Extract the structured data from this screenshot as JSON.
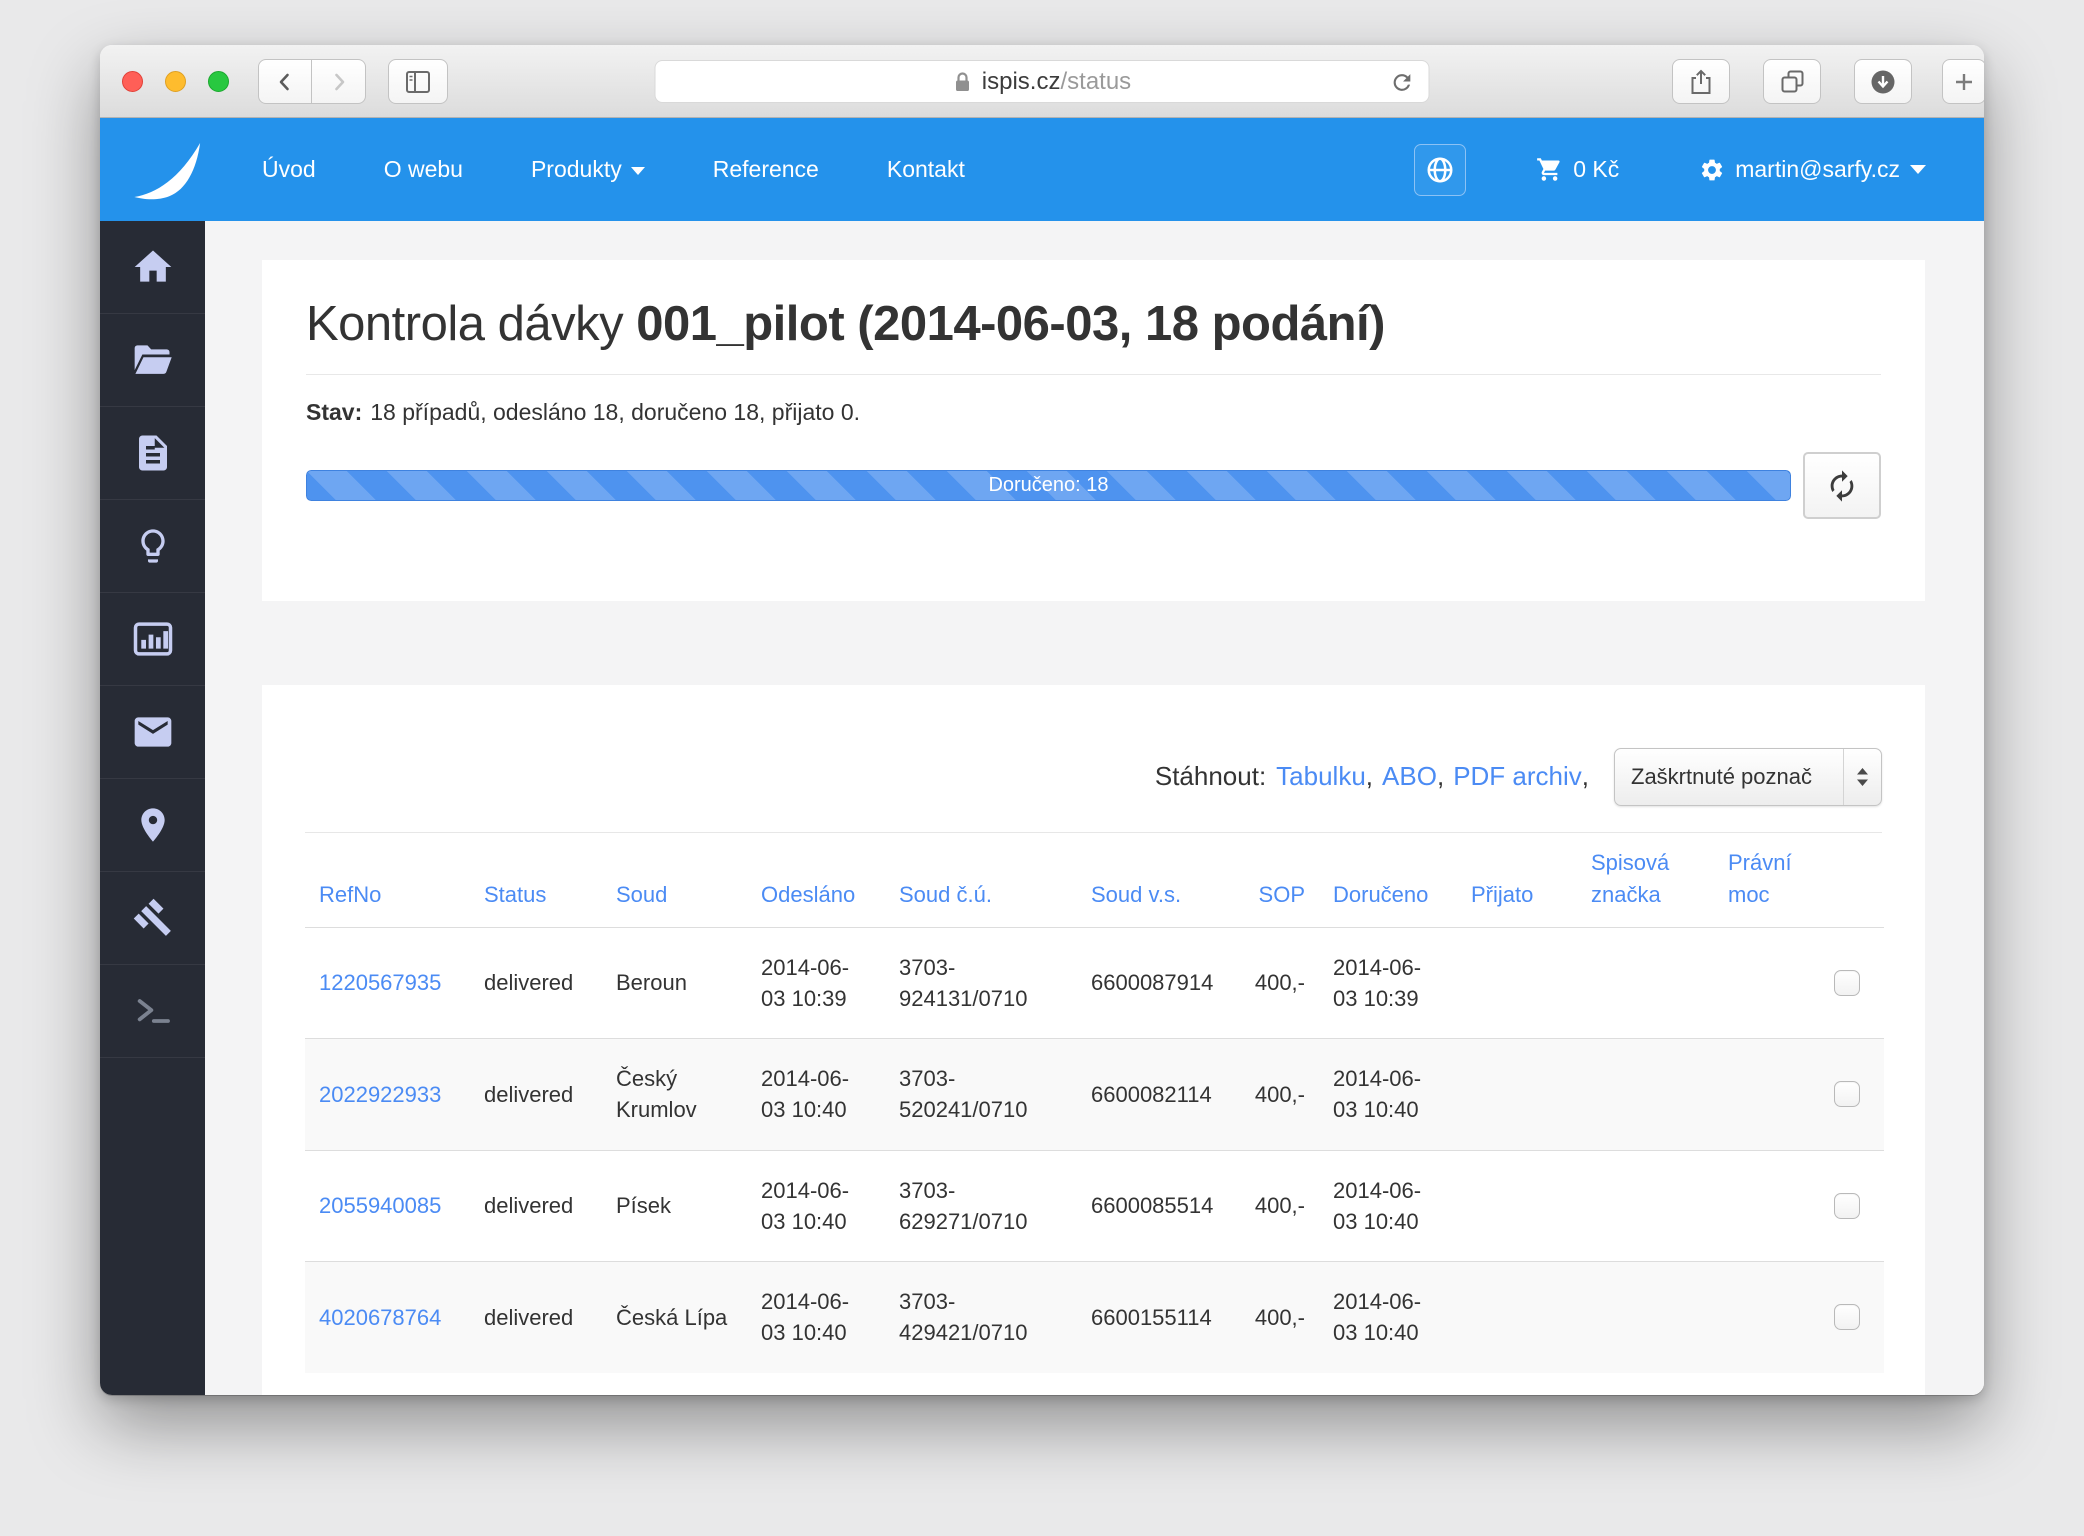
{
  "colors": {
    "navbar_blue": "#2492eb",
    "link_blue": "#4b8bf4",
    "progress_blue": "#4e93ef",
    "sidebar_bg": "#272b35",
    "sidebar_icon": "#c6cdf1"
  },
  "browser": {
    "domain": "ispis.cz",
    "path": "/status"
  },
  "navbar": {
    "items": [
      {
        "label": "Úvod"
      },
      {
        "label": "O webu"
      },
      {
        "label": "Produkty"
      },
      {
        "label": "Reference"
      },
      {
        "label": "Kontakt"
      }
    ],
    "cart_amount": "0 Kč",
    "user_email": "martin@sarfy.cz"
  },
  "status_panel": {
    "title_prefix": "Kontrola dávky ",
    "title_strong": "001_pilot (2014-06-03, 18 podání)",
    "status_label": "Stav:",
    "status_text": "18 případů, odesláno 18, doručeno 18, přijato 0.",
    "progress": {
      "label": "Doručeno: 18",
      "percent": 100
    }
  },
  "downloads": {
    "label": "Stáhnout:",
    "links": [
      {
        "label": "Tabulku"
      },
      {
        "label": "ABO"
      },
      {
        "label": "PDF archiv"
      }
    ],
    "comma": ",",
    "select_value": "Zaškrtnuté poznač"
  },
  "table": {
    "columns": [
      "RefNo",
      "Status",
      "Soud",
      "Odesláno",
      "Soud č.ú.",
      "Soud v.s.",
      "SOP",
      "Doručeno",
      "Přijato",
      "Spisová značka",
      "Právní moc"
    ],
    "rows": [
      {
        "refno": "1220567935",
        "status": "delivered",
        "soud": "Beroun",
        "odeslano": "2014-06-03 10:39",
        "soud_cu": "3703-924131/0710",
        "soud_vs": "6600087914",
        "sop": "400,-",
        "doruceno": "2014-06-03 10:39",
        "prijato": "",
        "spisova": ""
      },
      {
        "refno": "2022922933",
        "status": "delivered",
        "soud": "Český Krumlov",
        "odeslano": "2014-06-03 10:40",
        "soud_cu": "3703-520241/0710",
        "soud_vs": "6600082114",
        "sop": "400,-",
        "doruceno": "2014-06-03 10:40",
        "prijato": "",
        "spisova": ""
      },
      {
        "refno": "2055940085",
        "status": "delivered",
        "soud": "Písek",
        "odeslano": "2014-06-03 10:40",
        "soud_cu": "3703-629271/0710",
        "soud_vs": "6600085514",
        "sop": "400,-",
        "doruceno": "2014-06-03 10:40",
        "prijato": "",
        "spisova": ""
      },
      {
        "refno": "4020678764",
        "status": "delivered",
        "soud": "Česká Lípa",
        "odeslano": "2014-06-03 10:40",
        "soud_cu": "3703-429421/0710",
        "soud_vs": "6600155114",
        "sop": "400,-",
        "doruceno": "2014-06-03 10:40",
        "prijato": "",
        "spisova": ""
      }
    ]
  }
}
